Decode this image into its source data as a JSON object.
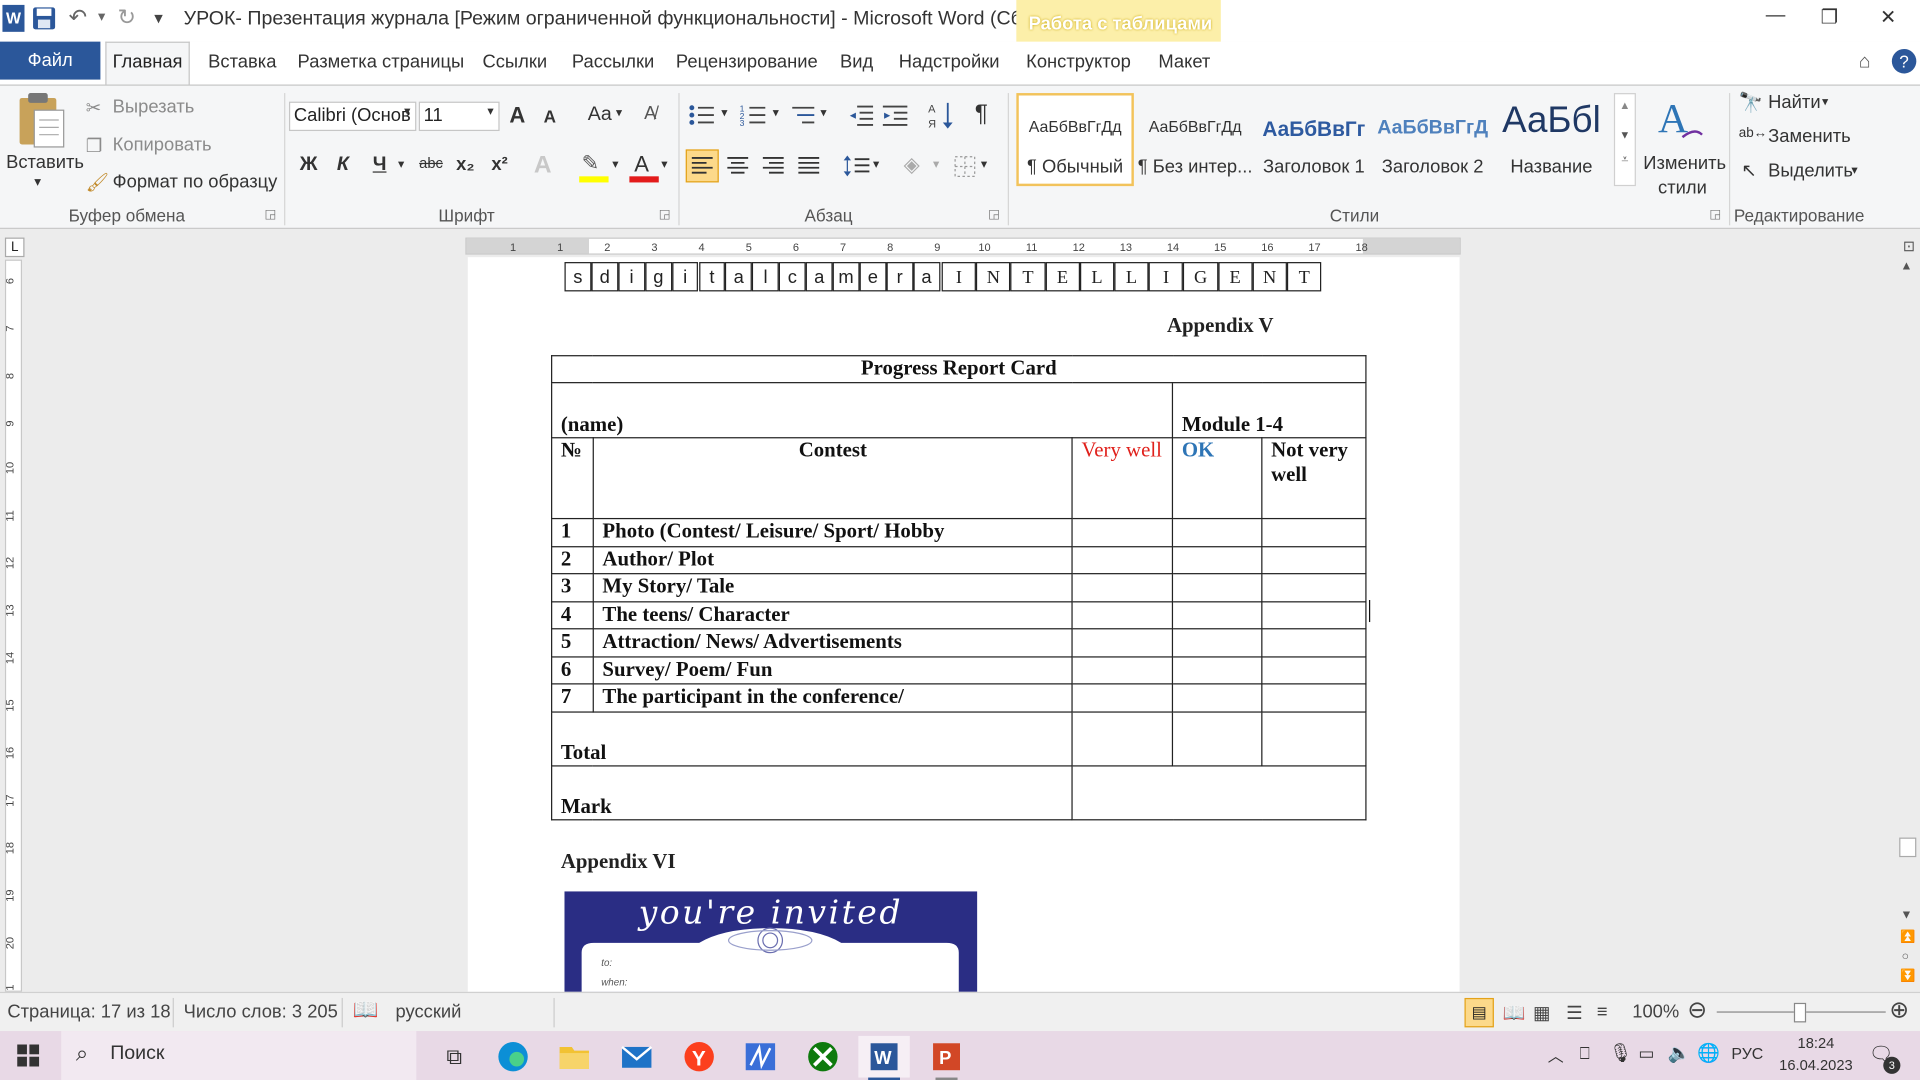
{
  "window": {
    "title": "УРОК- Презентация журнала [Режим ограниченной функциональности]  -  Microsoft Word (Сбой а...",
    "context_tab_group": "Работа с таблицами",
    "minimize": "—",
    "restore": "❐",
    "close": "✕"
  },
  "tabs": {
    "file": "Файл",
    "home": "Главная",
    "insert": "Вставка",
    "layout": "Разметка страницы",
    "references": "Ссылки",
    "mailings": "Рассылки",
    "review": "Рецензирование",
    "view": "Вид",
    "addins": "Надстройки",
    "design": "Конструктор",
    "table_layout": "Макет"
  },
  "clipboard": {
    "paste": "Вставить",
    "cut": "Вырезать",
    "copy": "Копировать",
    "format_painter": "Формат по образцу",
    "group": "Буфер обмена"
  },
  "font": {
    "name": "Calibri (Основ",
    "size": "11",
    "group": "Шрифт",
    "bold": "Ж",
    "italic": "К",
    "underline": "Ч",
    "strike": "abc",
    "subscript": "x₂",
    "superscript": "x²",
    "grow": "A",
    "shrink": "A",
    "case": "Aa",
    "color_highlight": "#ffff00",
    "color_font": "#e31b1b"
  },
  "paragraph": {
    "group": "Абзац",
    "pilcrow": "¶"
  },
  "styles": {
    "group": "Стили",
    "items": [
      {
        "preview": "АаБбВвГгДд",
        "name": "¶ Обычный"
      },
      {
        "preview": "АаБбВвГгДд",
        "name": "¶ Без интер..."
      },
      {
        "preview": "АаБбВвГг",
        "name": "Заголовок 1"
      },
      {
        "preview": "АаБбВвГгД",
        "name": "Заголовок 2"
      },
      {
        "preview": "АаБбl",
        "name": "Название"
      }
    ],
    "change": "Изменить стили"
  },
  "editing": {
    "group": "Редактирование",
    "find": "Найти",
    "replace": "Заменить",
    "select": "Выделить"
  },
  "ruler": {
    "h_marks": [
      "1",
      "1",
      "2",
      "3",
      "4",
      "5",
      "6",
      "7",
      "8",
      "9",
      "10",
      "11",
      "12",
      "13",
      "14",
      "15",
      "16",
      "17",
      "18"
    ],
    "v_marks": [
      "6",
      "7",
      "8",
      "9",
      "10",
      "11",
      "12",
      "13",
      "14",
      "15",
      "16",
      "17",
      "18",
      "19",
      "20",
      "21"
    ]
  },
  "document": {
    "letters_left": [
      "s",
      "d",
      "i",
      "g",
      "i",
      "t",
      "a",
      "l",
      "c",
      "a",
      "m",
      "e",
      "r",
      "a"
    ],
    "letters_right": [
      "I",
      "N",
      "T",
      "E",
      "L",
      "L",
      "I",
      "G",
      "E",
      "N",
      "T"
    ],
    "appendix_v": "Appendix  V",
    "table_title": "Progress Report Card",
    "name_label": "(name)",
    "module_label": "Module 1-4",
    "headers": {
      "no": "№",
      "contest": "Contest",
      "very_well": "Very well",
      "ok": "OK",
      "not_very_well": "Not very well"
    },
    "rows": [
      {
        "no": "1",
        "contest": "Photo (Contest/ Leisure/ Sport/ Hobby"
      },
      {
        "no": "2",
        "contest": "Author/ Plot"
      },
      {
        "no": "3",
        "contest": "My Story/ Tale"
      },
      {
        "no": "4",
        "contest": "The teens/ Character"
      },
      {
        "no": "5",
        "contest": "Attraction/ News/ Advertisements"
      },
      {
        "no": "6",
        "contest": "Survey/ Poem/ Fun"
      },
      {
        "no": "7",
        "contest": "The participant  in  the conference/"
      }
    ],
    "total": "Total",
    "mark": "Mark",
    "appendix_vi": "Appendix  VI",
    "invite_text": "you're invited",
    "invite_small_1": "to:",
    "invite_small_2": "when:"
  },
  "status": {
    "page": "Страница: 17 из 18",
    "words": "Число слов: 3 205",
    "lang": "русский",
    "zoom": "100%"
  },
  "taskbar": {
    "search": "Поиск",
    "lang": "РУС",
    "time": "18:24",
    "date": "16.04.2023",
    "notifications": "3"
  }
}
